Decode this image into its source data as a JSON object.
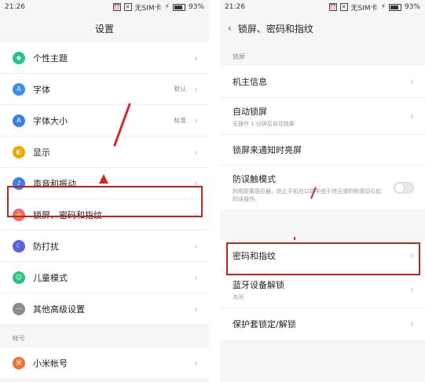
{
  "left": {
    "status": {
      "time": "21:26",
      "sim": "无SIM卡",
      "battery": "93%"
    },
    "title": "设置",
    "items_top": [
      {
        "label": "个性主题",
        "icon": "theme-icon",
        "color": "#27c38b"
      },
      {
        "label": "字体",
        "value": "默认",
        "icon": "font-icon",
        "color": "#3a8ee6"
      },
      {
        "label": "字体大小",
        "value": "标准",
        "icon": "font-size-icon",
        "color": "#3a7fe6"
      },
      {
        "label": "显示",
        "icon": "display-icon",
        "color": "#f2a600"
      },
      {
        "label": "声音和振动",
        "icon": "sound-icon",
        "color": "#3c7ee8"
      },
      {
        "label": "锁屏、密码和指纹",
        "icon": "lock-icon",
        "color": "#f06b6b"
      },
      {
        "label": "防打扰",
        "icon": "moon-icon",
        "color": "#5a63d8"
      },
      {
        "label": "儿童模式",
        "icon": "kids-icon",
        "color": "#2ec17e"
      },
      {
        "label": "其他高级设置",
        "icon": "more-icon",
        "color": "#8c8c8c"
      }
    ],
    "section_account": "帐号",
    "items_account": [
      {
        "label": "小米帐号",
        "icon": "mi-account-icon",
        "color": "#f0712f"
      }
    ]
  },
  "right": {
    "status": {
      "time": "21:26",
      "sim": "无SIM卡",
      "battery": "93%"
    },
    "title": "锁屏、密码和指纹",
    "section_lock": "锁屏",
    "items": [
      {
        "label": "机主信息"
      },
      {
        "label": "自动锁屏",
        "sub": "无操作 1 分钟后自动锁屏"
      },
      {
        "label": "锁屏来通知时亮屏"
      },
      {
        "label": "防误触模式",
        "sub": "利用距离感应器，防止手机在口袋中由于挤压或织物滑动引起的误操作。"
      },
      {
        "label": "密码和指纹"
      },
      {
        "label": "蓝牙设备解锁",
        "sub": "关闭"
      },
      {
        "label": "保护套锁定/解锁"
      }
    ]
  },
  "colors": {
    "highlight": "#cc1f1f"
  }
}
